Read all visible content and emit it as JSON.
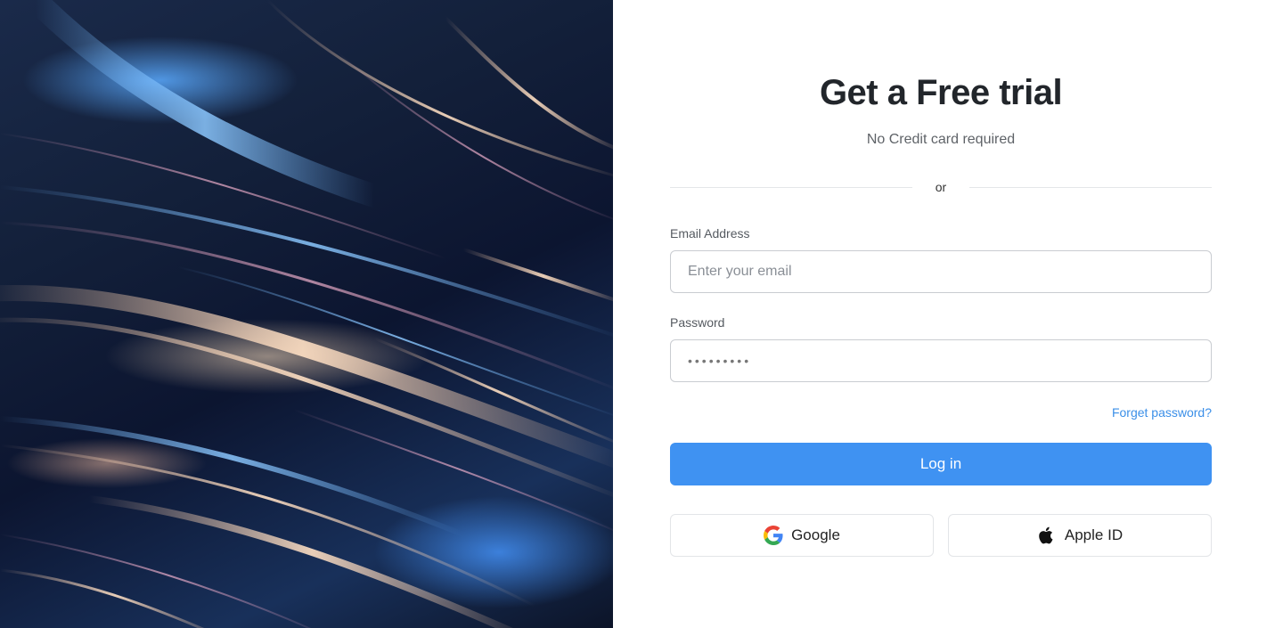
{
  "hero": {
    "icon": "abstract-light-streaks-image"
  },
  "form": {
    "title": "Get a Free trial",
    "subtitle": "No Credit card required",
    "divider_text": "or",
    "email": {
      "label": "Email Address",
      "placeholder": "Enter your email",
      "value": ""
    },
    "password": {
      "label": "Password",
      "value": "•••••••••"
    },
    "forgot_label": "Forget password?",
    "login_label": "Log in",
    "social": {
      "google_label": "Google",
      "apple_label": "Apple ID"
    }
  },
  "colors": {
    "accent": "#3f92f2",
    "link": "#3b8fe8",
    "title": "#22262b",
    "border": "#c9ccd1"
  }
}
